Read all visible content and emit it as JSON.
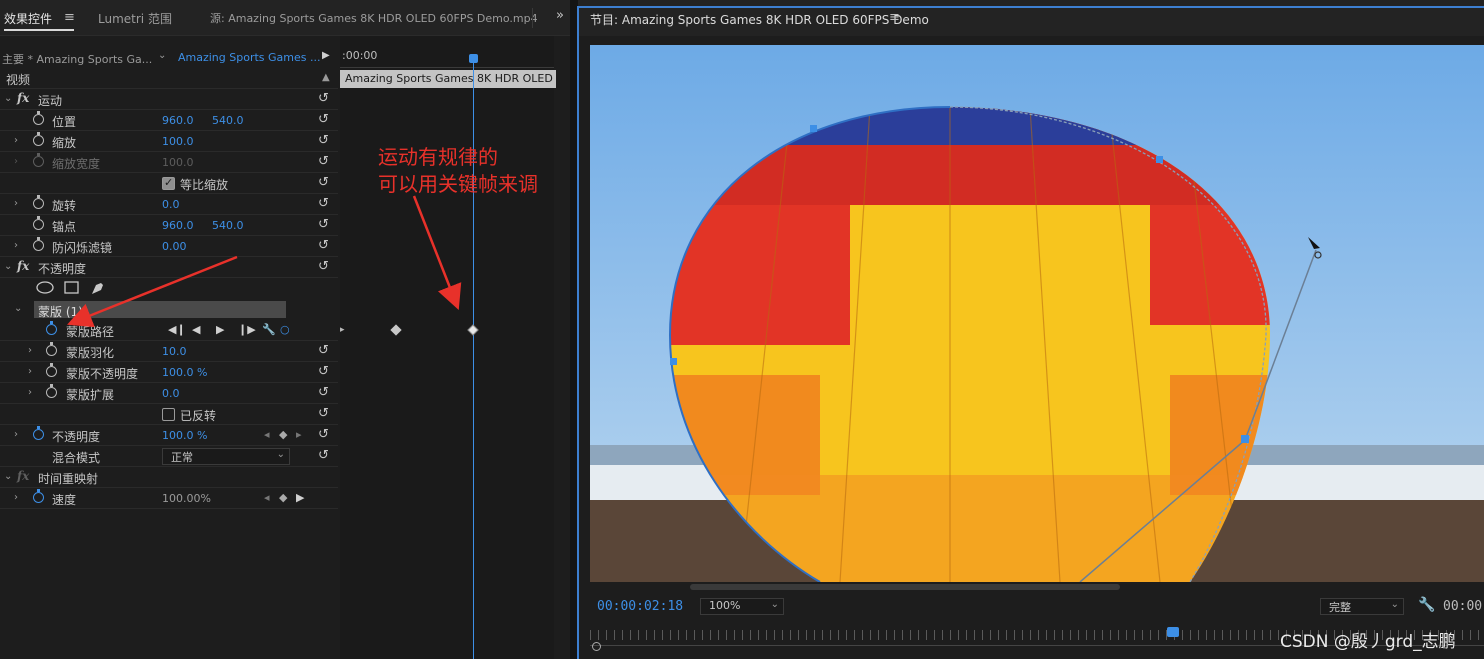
{
  "left_panel": {
    "tabs": {
      "effect_controls": "效果控件",
      "lumetri": "Lumetri 范围",
      "source": "源: Amazing Sports Games 8K HDR OLED 60FPS Demo.mp4"
    },
    "header": {
      "master": "主要 * Amazing Sports Ga...",
      "sequence": "Amazing Sports Games ..."
    },
    "section_video": "视频",
    "motion": {
      "label": "运动",
      "position": {
        "label": "位置",
        "x": "960.0",
        "y": "540.0"
      },
      "scale": {
        "label": "缩放",
        "value": "100.0"
      },
      "scale_width": {
        "label": "缩放宽度",
        "value": "100.0"
      },
      "uniform_scale": {
        "label": "等比缩放",
        "checked": true
      },
      "rotation": {
        "label": "旋转",
        "value": "0.0"
      },
      "anchor": {
        "label": "锚点",
        "x": "960.0",
        "y": "540.0"
      },
      "anti_flicker": {
        "label": "防闪烁滤镜",
        "value": "0.00"
      }
    },
    "opacity": {
      "label": "不透明度",
      "mask_name": "蒙版 (1)",
      "mask_path": {
        "label": "蒙版路径"
      },
      "mask_feather": {
        "label": "蒙版羽化",
        "value": "10.0"
      },
      "mask_opacity": {
        "label": "蒙版不透明度",
        "value": "100.0 %"
      },
      "mask_expansion": {
        "label": "蒙版扩展",
        "value": "0.0"
      },
      "inverted": {
        "label": "已反转",
        "checked": false
      },
      "opacity_prop": {
        "label": "不透明度",
        "value": "100.0 %"
      },
      "blend_mode": {
        "label": "混合模式",
        "value": "正常"
      }
    },
    "time_remap": {
      "label": "时间重映射",
      "speed": {
        "label": "速度",
        "value": "100.00%"
      }
    },
    "timeline": {
      "time": ":00:00",
      "clip_name": "Amazing Sports Games 8K HDR OLED 60F"
    },
    "annotation": {
      "line1": "运动有规律的",
      "line2": "可以用关键帧来调"
    }
  },
  "program_monitor": {
    "title": "节目: Amazing Sports Games 8K HDR OLED 60FPS Demo",
    "timecode": "00:00:02:18",
    "zoom": "100%",
    "quality": "完整",
    "timecode_right": "00:00:",
    "watermark": "CSDN @殷丿grd_志鹏"
  },
  "icons": [
    "menu-icon",
    "chevron-double-right-icon",
    "stopwatch-icon",
    "reset-icon",
    "ellipse-tool-icon",
    "rectangle-tool-icon",
    "pen-tool-icon",
    "wrench-icon",
    "play-icon",
    "step-back-icon",
    "step-forward-icon"
  ],
  "colors": {
    "accent": "#3d8fe6",
    "annotation": "#e8312a",
    "panel_bg": "#1d1d1d"
  }
}
